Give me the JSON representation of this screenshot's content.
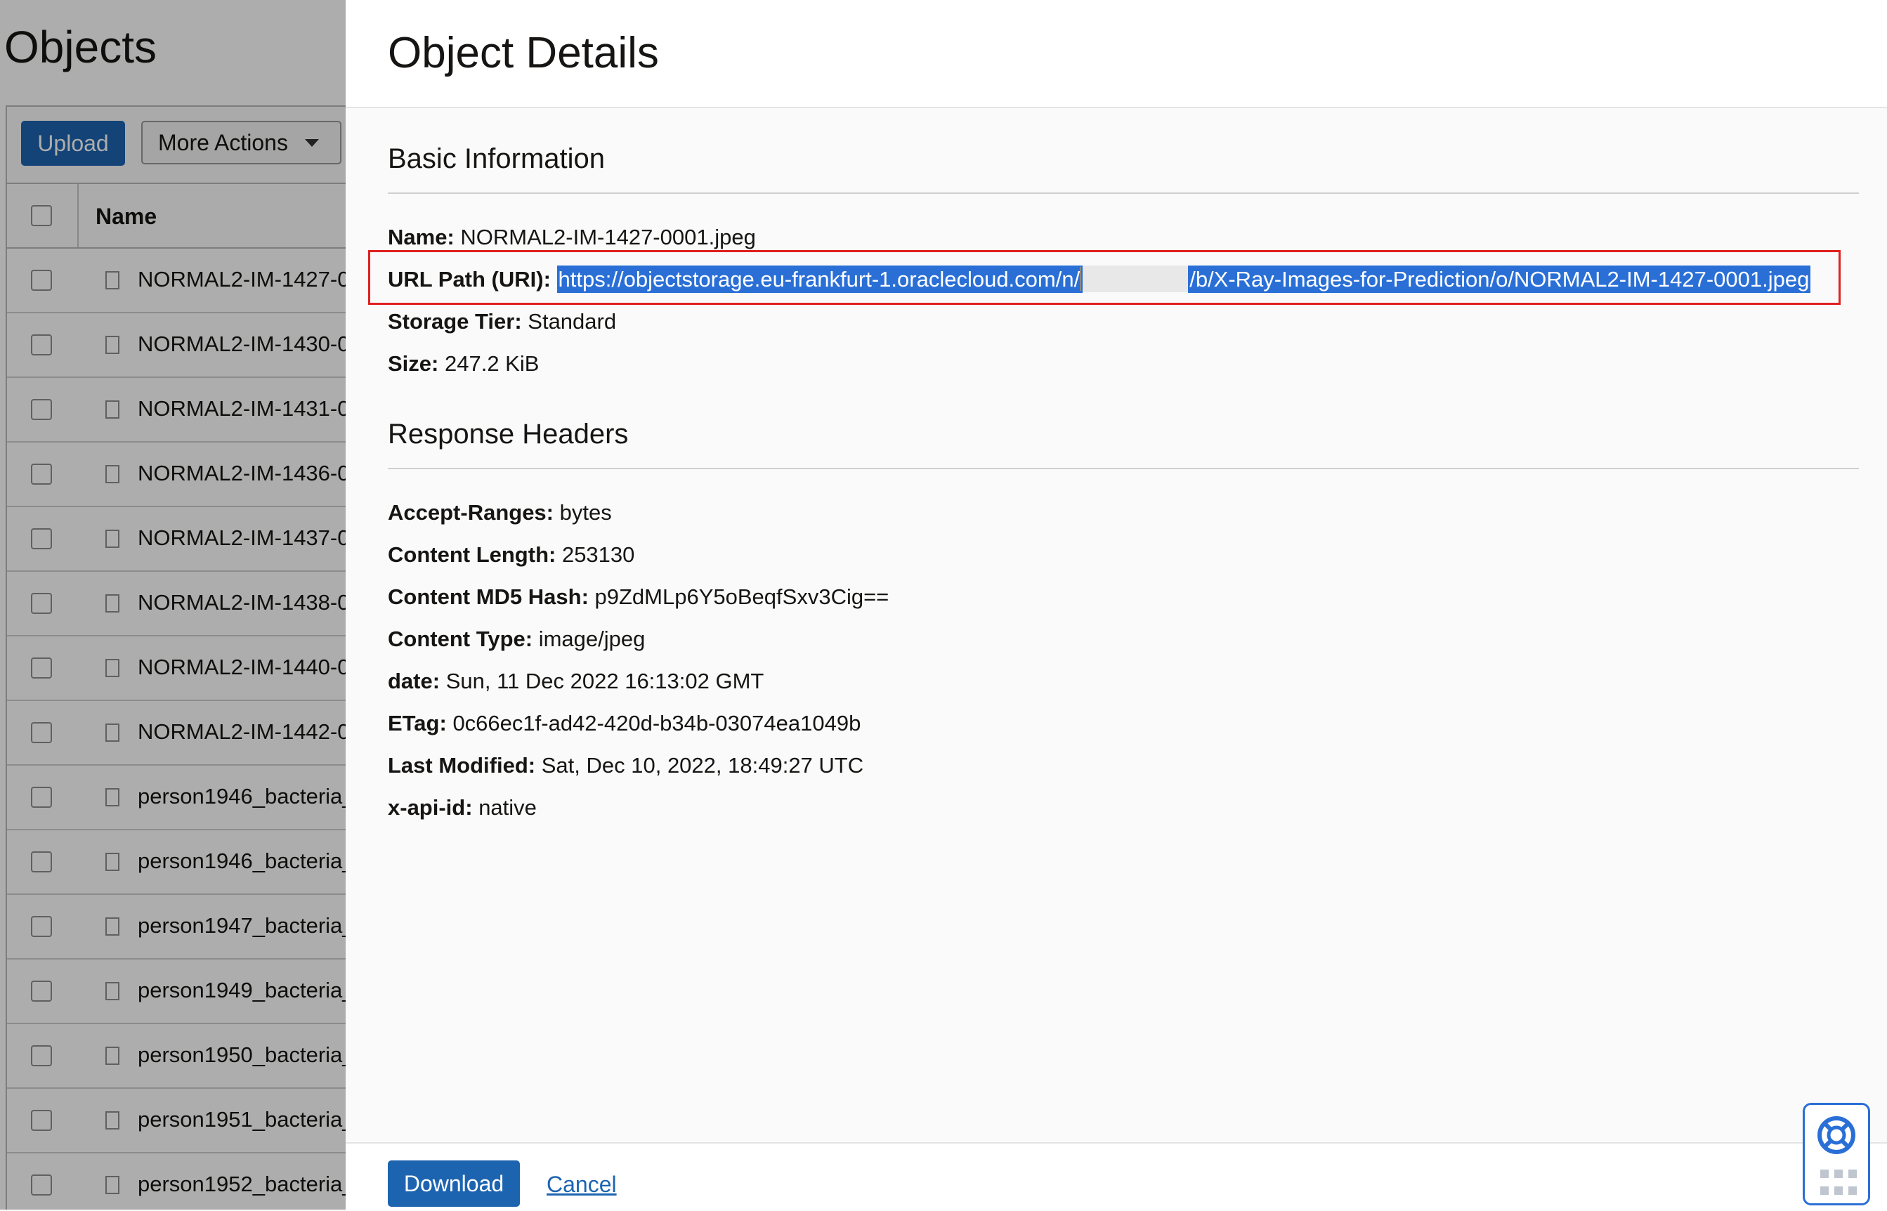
{
  "left_panel": {
    "title": "Objects",
    "upload_label": "Upload",
    "more_actions_label": "More Actions",
    "name_column": "Name",
    "rows": [
      "NORMAL2-IM-1427-0",
      "NORMAL2-IM-1430-0",
      "NORMAL2-IM-1431-0",
      "NORMAL2-IM-1436-0",
      "NORMAL2-IM-1437-0",
      "NORMAL2-IM-1438-0",
      "NORMAL2-IM-1440-0",
      "NORMAL2-IM-1442-0",
      "person1946_bacteria_",
      "person1946_bacteria_",
      "person1947_bacteria_",
      "person1949_bacteria_",
      "person1950_bacteria_",
      "person1951_bacteria_",
      "person1952_bacteria_"
    ]
  },
  "drawer": {
    "title": "Object Details",
    "basic_info": {
      "heading": "Basic Information",
      "name_label": "Name:",
      "name_value": "NORMAL2-IM-1427-0001.jpeg",
      "url_label": "URL Path (URI):",
      "url_prefix": "https://objectstorage.eu-frankfurt-1.oraclecloud.com/n/",
      "url_suffix": "/b/X-Ray-Images-for-Prediction/o/NORMAL2-IM-1427-0001.jpeg",
      "storage_label": "Storage Tier:",
      "storage_value": "Standard",
      "size_label": "Size:",
      "size_value": "247.2 KiB"
    },
    "response_headers": {
      "heading": "Response Headers",
      "items": [
        {
          "label": "Accept-Ranges:",
          "value": "bytes"
        },
        {
          "label": "Content Length:",
          "value": "253130"
        },
        {
          "label": "Content MD5 Hash:",
          "value": "p9ZdMLp6Y5oBeqfSxv3Cig=="
        },
        {
          "label": "Content Type:",
          "value": "image/jpeg"
        },
        {
          "label": "date:",
          "value": "Sun, 11 Dec 2022 16:13:02 GMT"
        },
        {
          "label": "ETag:",
          "value": "0c66ec1f-ad42-420d-b34b-03074ea1049b"
        },
        {
          "label": "Last Modified:",
          "value": "Sat, Dec 10, 2022, 18:49:27 UTC"
        },
        {
          "label": "x-api-id:",
          "value": "native"
        }
      ]
    },
    "footer": {
      "download_label": "Download",
      "cancel_label": "Cancel"
    }
  },
  "colors": {
    "primary": "#1d64b0",
    "highlight_box": "#e02020",
    "selection": "#2a6fd6"
  }
}
